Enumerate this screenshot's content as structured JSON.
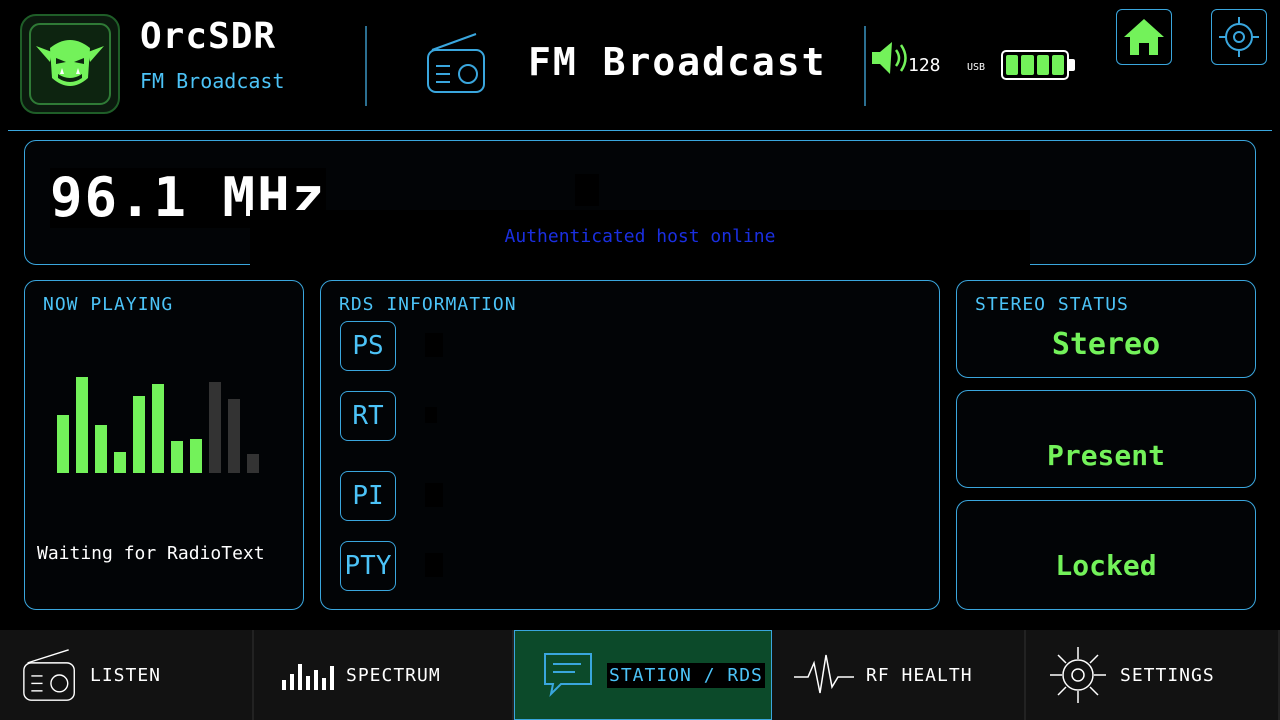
{
  "header": {
    "app_name": "OrcSDR",
    "app_subtitle": "FM Broadcast",
    "mode_title": "FM Broadcast",
    "volume_level": "128",
    "usb_label": "USB",
    "battery_cells": 4
  },
  "frequency": {
    "value": "96.1 MHz",
    "status_message": "Authenticated host online"
  },
  "now_playing": {
    "label": "NOW PLAYING",
    "radiotext": "Waiting for RadioText",
    "level_bars": [
      0.6,
      1.0,
      0.5,
      0.22,
      0.8,
      0.93,
      0.33,
      0.35,
      0.95,
      0.77,
      0.2
    ],
    "level_active": [
      true,
      true,
      true,
      true,
      true,
      true,
      true,
      true,
      false,
      false,
      false
    ]
  },
  "rds": {
    "label": "RDS INFORMATION",
    "fields": [
      "PS",
      "RT",
      "PI",
      "PTY"
    ]
  },
  "stereo": {
    "label": "STEREO STATUS",
    "mode": "Stereo",
    "pilot": "Present",
    "lock": "Locked"
  },
  "nav": {
    "items": [
      "LISTEN",
      "SPECTRUM",
      "STATION / RDS",
      "RF HEALTH",
      "SETTINGS"
    ],
    "active_index": 2
  },
  "colors": {
    "accent": "#4cc3f7",
    "ok": "#73f25a",
    "status_text": "#1a2fe0"
  }
}
